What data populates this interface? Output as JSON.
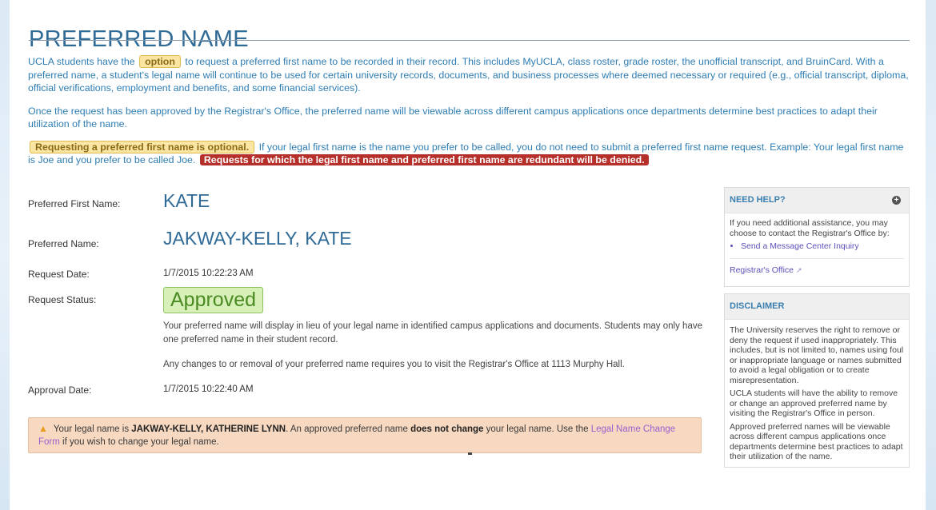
{
  "page": {
    "title": "PREFERRED NAME"
  },
  "intro": {
    "p1_before": "UCLA students have the",
    "p1_highlight": "option",
    "p1_after": "to request a preferred first name to be recorded in their record. This includes MyUCLA, class roster, grade roster, the unofficial transcript, and BruinCard. With a preferred name, a student's legal name will continue to be used for certain university records, documents, and business processes where deemed necessary or required (e.g., official transcript, diploma, official verifications, employment and benefits, and some financial services).",
    "p2": "Once the request has been approved by the Registrar's Office, the preferred name will be viewable across different campus applications once departments determine best practices to adapt their utilization of the name.",
    "p3_highlight": "Requesting a preferred first name is optional.",
    "p3_middle": "If your legal first name is the name you prefer to be called, you do not need to submit a preferred first name request. Example: Your legal first name is Joe and you prefer to be called Joe.",
    "p3_warning": "Requests for which the legal first name and preferred first name are redundant will be denied."
  },
  "details": {
    "preferred_first_name_label": "Preferred First Name:",
    "preferred_first_name": "KATE",
    "preferred_name_label": "Preferred Name:",
    "preferred_name": "JAKWAY-KELLY, KATE",
    "request_date_label": "Request Date:",
    "request_date": "1/7/2015 10:22:23 AM",
    "request_status_label": "Request Status:",
    "request_status": "Approved",
    "status_note_1": "Your preferred name will display in lieu of your legal name in identified campus applications and documents. Students may only have one preferred name in their student record.",
    "status_note_2": "Any changes to or removal of your preferred name requires you to visit the Registrar's Office at 1113 Murphy Hall.",
    "approval_date_label": "Approval Date:",
    "approval_date": "1/7/2015 10:22:40 AM"
  },
  "alert": {
    "icon": "warning-triangle-icon",
    "text_1": "Your legal name is",
    "legal_name": "JAKWAY-KELLY, KATHERINE LYNN",
    "text_2": ". An approved preferred name",
    "emphasis": "does not change",
    "text_3": "your legal name. Use the",
    "link": "Legal Name Change Form",
    "text_4": "if you wish to change your legal name."
  },
  "sidebar": {
    "help": {
      "title": "NEED HELP?",
      "icon": "plus-circle-icon",
      "text": "If you need additional assistance, you may choose to contact the Registrar's Office by:",
      "links": [
        "Send a Message Center Inquiry"
      ],
      "office_link": "Registrar's Office",
      "office_link_icon": "external-link-icon"
    },
    "disclaimer": {
      "title": "DISCLAIMER",
      "paragraphs": [
        "The University reserves the right to remove or deny the request if used inappropriately. This includes, but is not limited to, names using foul or inappropriate language or names submitted to avoid a legal obligation or to create misrepresentation.",
        "UCLA students will have the ability to remove or change an approved preferred name by visiting the Registrar's Office in person.",
        "Approved preferred names will be viewable across different campus applications once departments determine best practices to adapt their utilization of the name."
      ]
    }
  },
  "colors": {
    "title": "#2f6a96",
    "intro_text": "#2e7db3",
    "highlight_yellow": "#fbe5a3",
    "highlight_red": "#b5302a",
    "status_green_bg": "#d6f0b8",
    "alert_bg": "#f7d8c0",
    "link_purple": "#9b5fd0"
  }
}
